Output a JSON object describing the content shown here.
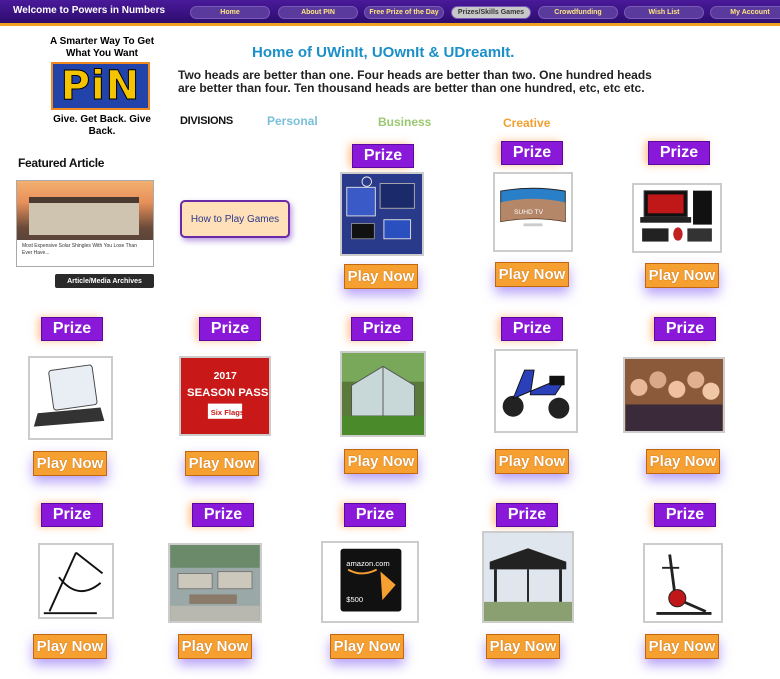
{
  "header": {
    "site_title": "Welcome to Powers in Numbers",
    "nav": [
      "Home",
      "About PIN",
      "Free Prize of the Day",
      "Prizes/Skills Games",
      "Crowdfunding",
      "Wish List",
      "My Account"
    ]
  },
  "logo": {
    "tagline_top": "A Smarter Way To Get What You Want",
    "letters": "PiN",
    "tagline_bottom": "Give. Get Back. Give Back."
  },
  "headline": "Home of UWinIt, UOwnIt & UDreamIt.",
  "intro": "Two heads are better than one. Four heads are better than two. One hundred heads are better than four. Ten thousand heads are better than one hundred, etc, etc etc.",
  "divisions": {
    "label": "DIVISIONS",
    "personal": "Personal",
    "business": "Business",
    "creative": "Creative"
  },
  "featured": {
    "label": "Featured Article",
    "caption": "Most Expensive Solar Shingles With You Lose Than Ever Have...",
    "archives": "Article/Media Archives"
  },
  "how_to_play": "How to Play Games",
  "prize_label": "Prize",
  "play_label": "Play Now",
  "colors": {
    "nav_bg": "#4a1a9a",
    "prize": "#8a18d8",
    "play": "#f5a030",
    "headline": "#1a8fc8"
  },
  "prizes": [
    {
      "icon": "solar-kit-icon"
    },
    {
      "icon": "tv-icon",
      "screen_text": "SUHD TV"
    },
    {
      "icon": "gaming-laptop-icon"
    },
    {
      "icon": "tablet-icon"
    },
    {
      "icon": "season-pass-icon",
      "year": "2017",
      "title": "SEASON PASS",
      "brand": "Six Flags"
    },
    {
      "icon": "greenhouse-icon"
    },
    {
      "icon": "scooter-icon"
    },
    {
      "icon": "group-photo-icon"
    },
    {
      "icon": "hammock-chair-icon"
    },
    {
      "icon": "patio-furniture-icon"
    },
    {
      "icon": "gift-card-icon",
      "brand": "amazon.com",
      "amount": "$500"
    },
    {
      "icon": "gazebo-icon"
    },
    {
      "icon": "elliptical-icon"
    }
  ]
}
